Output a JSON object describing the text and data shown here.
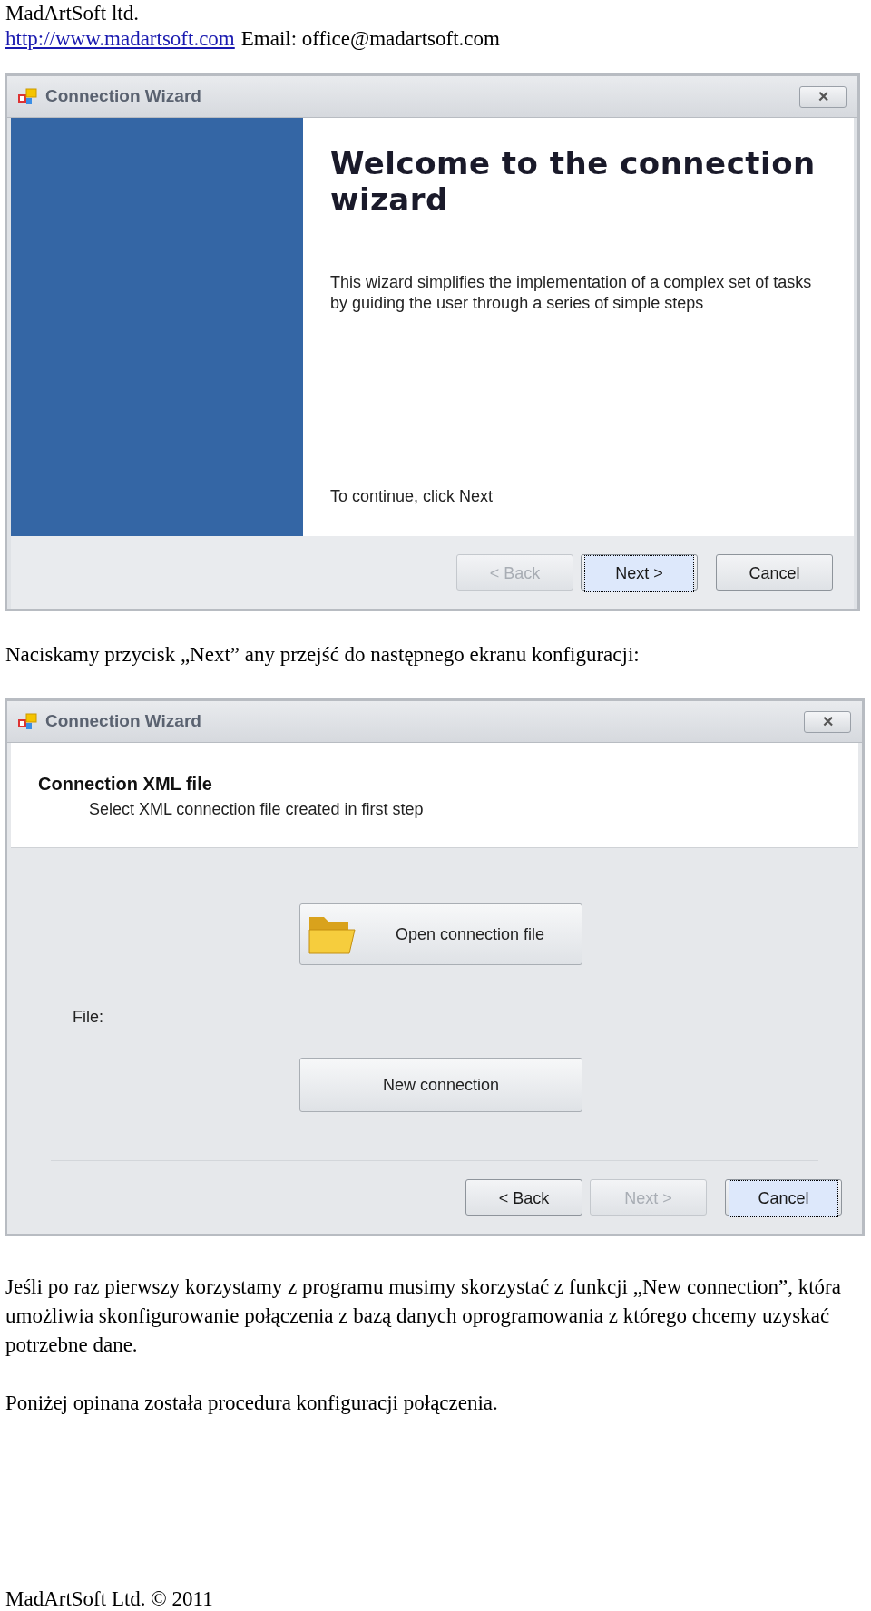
{
  "header": {
    "company": "MadArtSoft ltd.",
    "link": "http://www.madartsoft.com",
    "email": "Email: office@madartsoft.com"
  },
  "window_1": {
    "title": "Connection Wizard",
    "close": "✕",
    "heading": "Welcome to the connection wizard",
    "description": "This wizard simplifies the implementation of a complex set of tasks by guiding the user through a series of simple steps",
    "hint": "To continue, click Next",
    "buttons": [
      {
        "label": "< Back",
        "disabled": true,
        "focused": false
      },
      {
        "label": "Next >",
        "disabled": false,
        "focused": true
      },
      {
        "label": "Cancel",
        "disabled": false,
        "focused": false
      }
    ]
  },
  "paragraph_1": "Naciskamy przycisk „Next” any przejść do następnego ekranu konfiguracji:",
  "window_2": {
    "title": "Connection Wizard",
    "close": "✕",
    "heading": "Connection XML file",
    "subheading": "Select XML connection file created in first step",
    "open_button": "Open connection file",
    "file_label": "File:",
    "new_button": "New connection",
    "buttons": [
      {
        "label": "< Back",
        "disabled": false,
        "focused": false
      },
      {
        "label": "Next >",
        "disabled": true,
        "focused": false
      },
      {
        "label": "Cancel",
        "disabled": false,
        "focused": true
      }
    ]
  },
  "paragraph_2": "Jeśli po raz pierwszy korzystamy z programu musimy skorzystać z funkcji „New connection”, która umożliwia skonfigurowanie połączenia z bazą danych oprogramowania z którego chcemy uzyskać potrzebne dane.",
  "paragraph_3": "Poniżej opinana została procedura konfiguracji połączenia.",
  "footer": "MadArtSoft Ltd. © 2011"
}
